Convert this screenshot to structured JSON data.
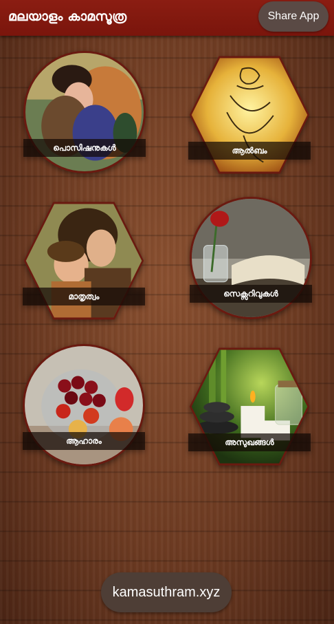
{
  "app": {
    "title": "മലയാളം കാമസൂത്ര",
    "share_label": "Share App"
  },
  "tiles": [
    {
      "label": "പൊസിഷനുകൾ",
      "shape": "circle",
      "image": "embrace-painting"
    },
    {
      "label": "ആൽബം",
      "shape": "hexagon",
      "image": "sketch-figure"
    },
    {
      "label": "മാതൃത്വം",
      "shape": "hexagon",
      "image": "mother-child-painting"
    },
    {
      "label": "സെക്സറിവുകൾ",
      "shape": "circle",
      "image": "rose-and-book"
    },
    {
      "label": "ആഹാരം",
      "shape": "circle",
      "image": "fruit-basket"
    },
    {
      "label": "അസുഖങ്ങൾ",
      "shape": "hexagon",
      "image": "spa-stones-candles"
    }
  ],
  "footer": {
    "site_label": "kamasuthram.xyz"
  },
  "colors": {
    "appbar": "#7a150c",
    "tile_border": "#6a1a10",
    "pill": "#4e3e36"
  }
}
